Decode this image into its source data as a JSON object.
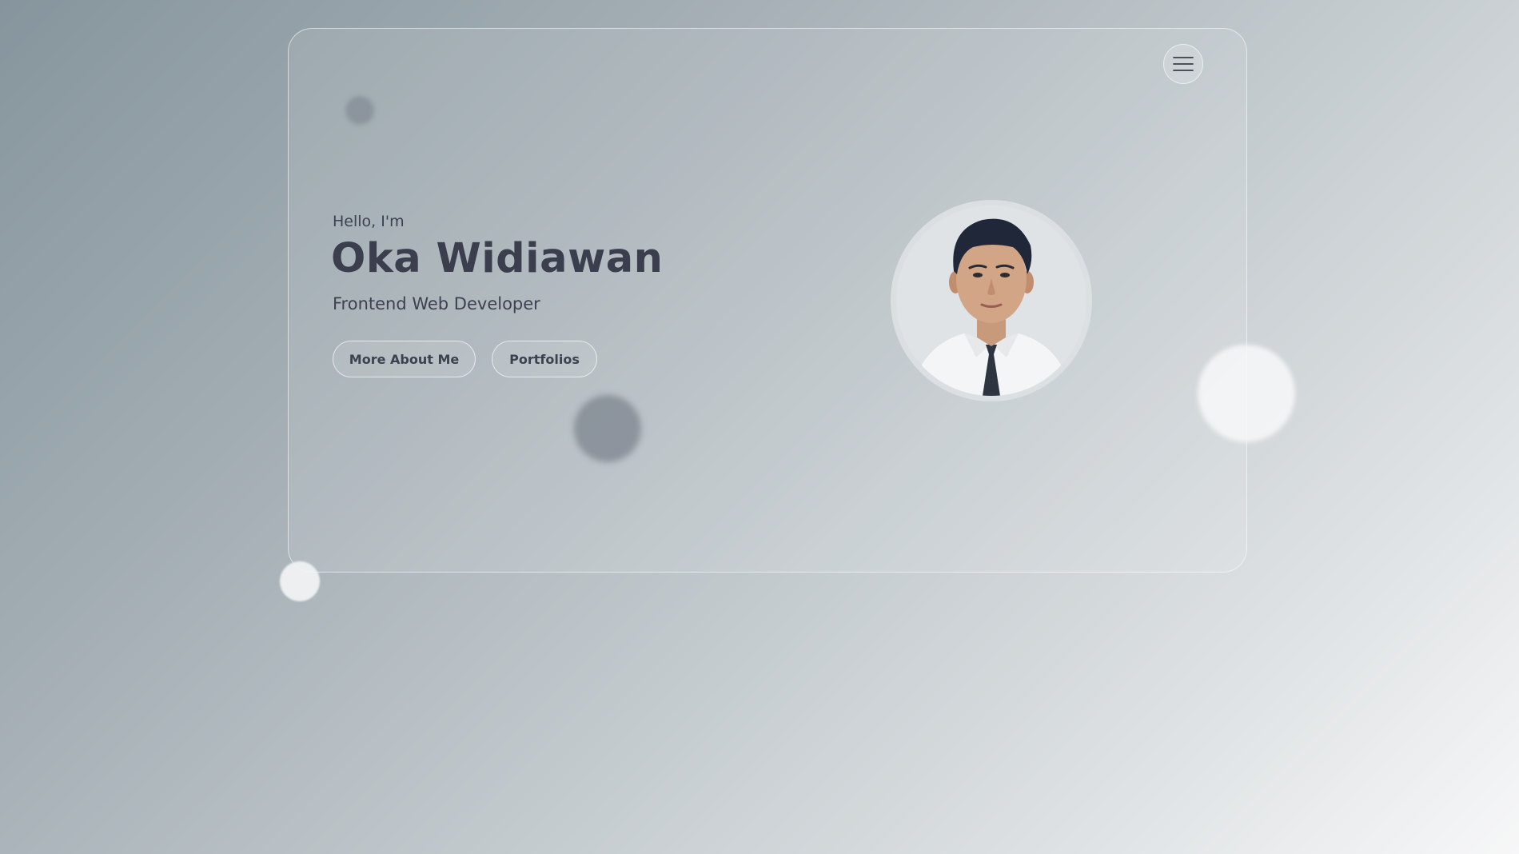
{
  "hero": {
    "greeting": "Hello, I'm",
    "name": "Oka Widiawan",
    "role": "Frontend Web Developer"
  },
  "buttons": {
    "about": "More About Me",
    "portfolios": "Portfolios"
  },
  "icons": {
    "menu": "hamburger-menu-icon"
  },
  "colors": {
    "text_primary": "#3b3e4c",
    "background_start": "#86959d",
    "background_end": "#f7f7f8"
  }
}
